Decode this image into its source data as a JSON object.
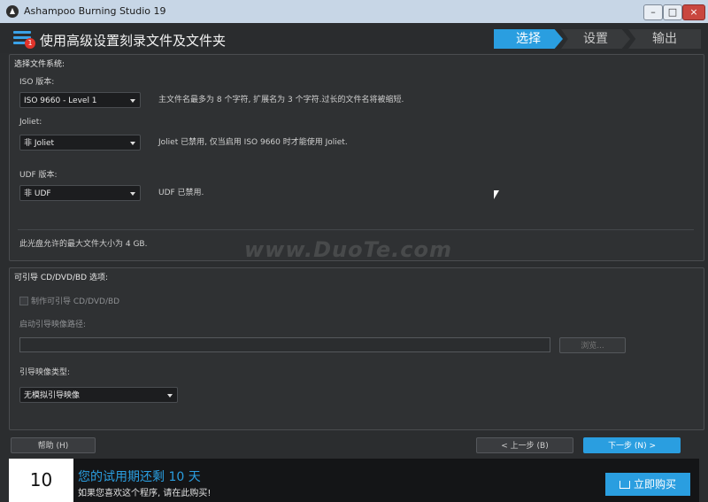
{
  "window": {
    "title": "Ashampoo Burning Studio 19",
    "controls": {
      "minimize": "–",
      "maximize": "□",
      "close": "×"
    }
  },
  "header": {
    "menu_badge": "1",
    "page_title": "使用高级设置刻录文件及文件夹",
    "steps": [
      "选择",
      "设置",
      "输出"
    ]
  },
  "file_system": {
    "title": "选择文件系统:",
    "iso": {
      "label": "ISO 版本:",
      "value": "ISO 9660 - Level 1",
      "desc": "主文件名最多为 8 个字符, 扩展名为 3 个字符.过长的文件名将被缩短."
    },
    "joliet": {
      "label": "Joliet:",
      "value": "非 Joliet",
      "desc": "Joliet 已禁用, 仅当启用 ISO 9660 时才能使用 Joliet."
    },
    "udf": {
      "label": "UDF 版本:",
      "value": "非 UDF",
      "desc": "UDF 已禁用."
    },
    "max_size_note": "此光盘允许的最大文件大小为 4 GB."
  },
  "watermark": "www.DuoTe.com",
  "boot": {
    "title": "可引导 CD/DVD/BD 选项:",
    "make_bootable_label": "制作可引导 CD/DVD/BD",
    "image_path_label": "启动引导映像路径:",
    "image_path_value": "",
    "browse_label": "浏览...",
    "image_type_label": "引导映像类型:",
    "image_type_value": "无模拟引导映像"
  },
  "footer": {
    "help_label": "帮助 (H)",
    "prev_label": "< 上一步 (B)",
    "next_label": "下一步 (N) >"
  },
  "trial": {
    "days": "10",
    "title": "您的试用期还剩 10 天",
    "subtitle": "如果您喜欢这个程序, 请在此购买!",
    "buy_label": "立即购买"
  },
  "colors": {
    "accent": "#2a9ee0",
    "background": "#2b2d2f",
    "badge": "#e0342b"
  },
  "icons": {
    "app": "app-logo-icon",
    "menu": "hamburger-menu-icon",
    "cart": "shopping-cart-icon"
  }
}
